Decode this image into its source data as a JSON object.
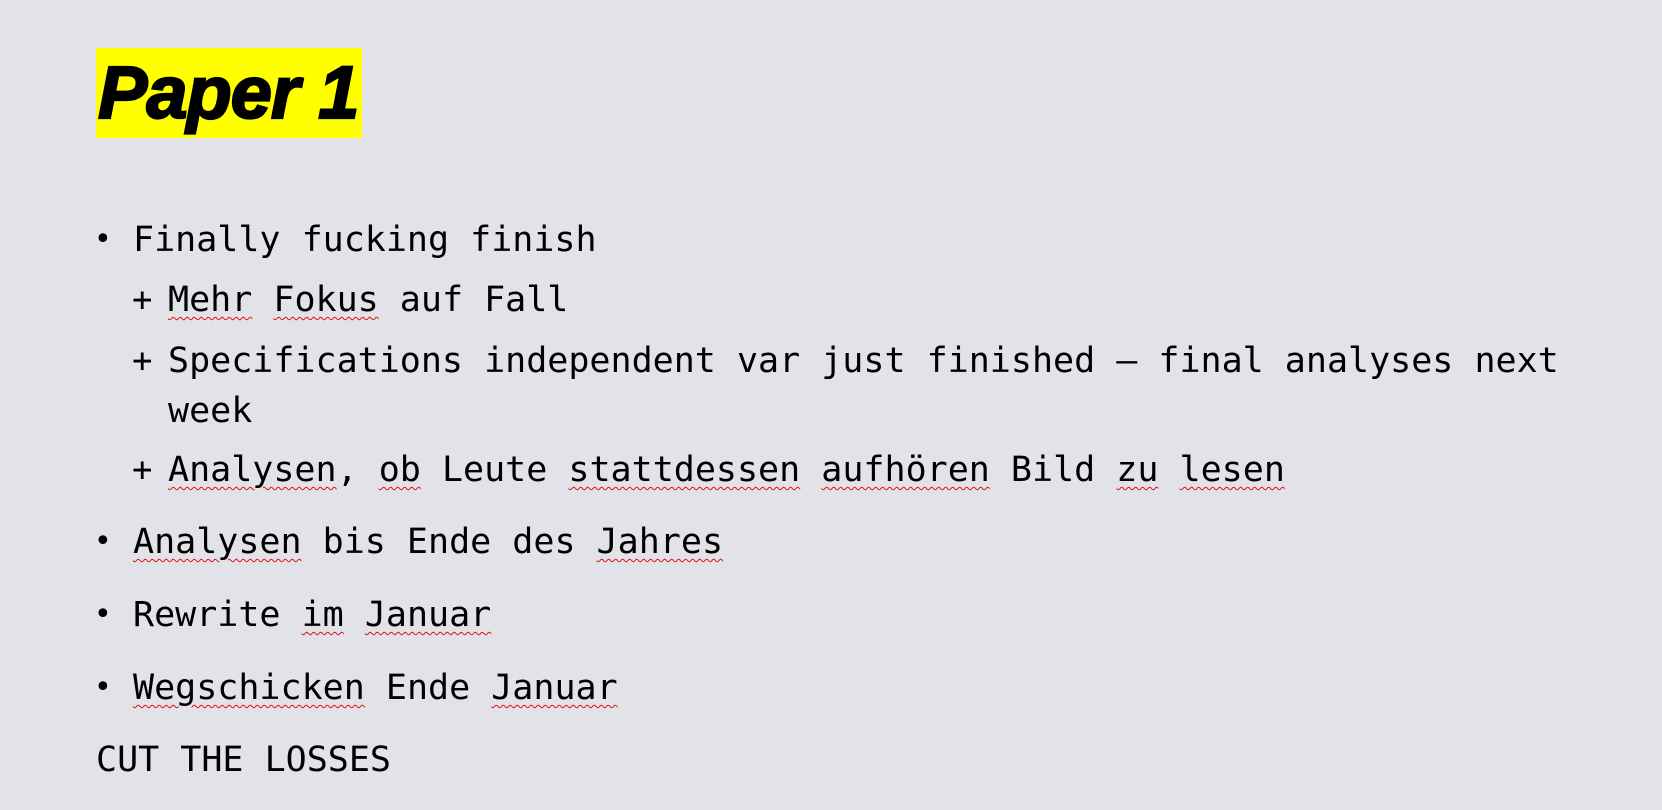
{
  "slide": {
    "title": "Paper 1",
    "title_highlight_color": "#ffff00",
    "background_color": "#e2e3e8",
    "bullet_glyph": "•",
    "sub_bullet_glyph": "+",
    "items": [
      {
        "text": "Finally fucking finish",
        "subitems": [
          {
            "parts": [
              {
                "t": "Mehr",
                "spell": true
              },
              {
                "t": " ",
                "spell": false
              },
              {
                "t": "Fokus",
                "spell": true
              },
              {
                "t": " auf Fall",
                "spell": false
              }
            ]
          },
          {
            "line1": "Specifications independent var just finished – final analyses next",
            "line2": "week"
          },
          {
            "parts": [
              {
                "t": "Analysen",
                "spell": true
              },
              {
                "t": ", ",
                "spell": false
              },
              {
                "t": "ob",
                "spell": true
              },
              {
                "t": " Leute ",
                "spell": false
              },
              {
                "t": "stattdessen",
                "spell": true
              },
              {
                "t": " ",
                "spell": false
              },
              {
                "t": "aufhören",
                "spell": true
              },
              {
                "t": " Bild ",
                "spell": false
              },
              {
                "t": "zu",
                "spell": true
              },
              {
                "t": " ",
                "spell": false
              },
              {
                "t": "lesen",
                "spell": true
              }
            ]
          }
        ]
      },
      {
        "parts": [
          {
            "t": "Analysen",
            "spell": true
          },
          {
            "t": " bis Ende des ",
            "spell": false
          },
          {
            "t": "Jahres",
            "spell": true
          }
        ]
      },
      {
        "parts": [
          {
            "t": "Rewrite ",
            "spell": false
          },
          {
            "t": "im",
            "spell": true
          },
          {
            "t": " ",
            "spell": false
          },
          {
            "t": "Januar",
            "spell": true
          }
        ]
      },
      {
        "parts": [
          {
            "t": "Wegschicken",
            "spell": true
          },
          {
            "t": " Ende ",
            "spell": false
          },
          {
            "t": "Januar",
            "spell": true
          }
        ]
      }
    ],
    "footer_text": "CUT THE LOSSES"
  }
}
